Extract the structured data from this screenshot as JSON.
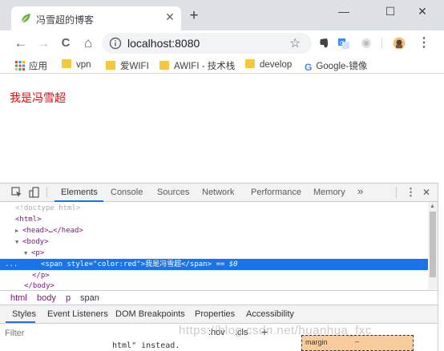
{
  "tab": {
    "title": "冯雪超的博客",
    "close_glyph": "✕",
    "new_tab_glyph": "+"
  },
  "window": {
    "minimize": "—",
    "maximize": "☐",
    "close": "✕"
  },
  "toolbar": {
    "back": "←",
    "forward": "→",
    "reload": "C",
    "home": "⌂",
    "star": "☆",
    "menu": "⋮"
  },
  "omnibox": {
    "url": "localhost:8080"
  },
  "bookmarks": [
    {
      "label": "应用",
      "icon": "apps-grid-icon"
    },
    {
      "label": "vpn",
      "icon": "folder-icon"
    },
    {
      "label": "爱WIFI",
      "icon": "folder-icon"
    },
    {
      "label": "AWIFI - 技术栈",
      "icon": "folder-icon"
    },
    {
      "label": "develop",
      "icon": "folder-icon"
    },
    {
      "label": "Google-镜像",
      "icon": "google-icon"
    }
  ],
  "page": {
    "text": "我是冯雪超",
    "text_color": "#ff0000"
  },
  "devtools": {
    "tabs": [
      "Elements",
      "Console",
      "Sources",
      "Network",
      "Performance",
      "Memory"
    ],
    "more_tabs": "»",
    "menu": "⋮",
    "close": "✕",
    "dom": {
      "doctype": "<!doctype html>",
      "html_open": "<html>",
      "head_open": "<head>",
      "head_ellipsis": "…",
      "head_close": "</head>",
      "body_open": "<body>",
      "p_open": "<p>",
      "span_open": "<span",
      "span_attr_name": "style",
      "span_attr_value": "\"color:red\"",
      "span_close_bracket": ">",
      "span_text": "我是冯雪超",
      "span_close": "</span>",
      "eq_marker": "== $0",
      "p_close": "</p>",
      "body_close": "</body>",
      "gutter_dots": "..."
    },
    "breadcrumbs": [
      "html",
      "body",
      "p",
      "span"
    ],
    "styles_tabs": [
      "Styles",
      "Event Listeners",
      "DOM Breakpoints",
      "Properties",
      "Accessibility"
    ],
    "filter_placeholder": "Filter",
    "hov": ":hov",
    ".cls": ".cls",
    "add": "+",
    "box_model": {
      "label": "margin",
      "value": "–"
    },
    "fragment": "html\" instead."
  },
  "watermark": "https://blog.csdn.net/huanhua_fxc",
  "colors": {
    "accent": "#1a73e8",
    "tab_strip": "#dee1e6"
  }
}
